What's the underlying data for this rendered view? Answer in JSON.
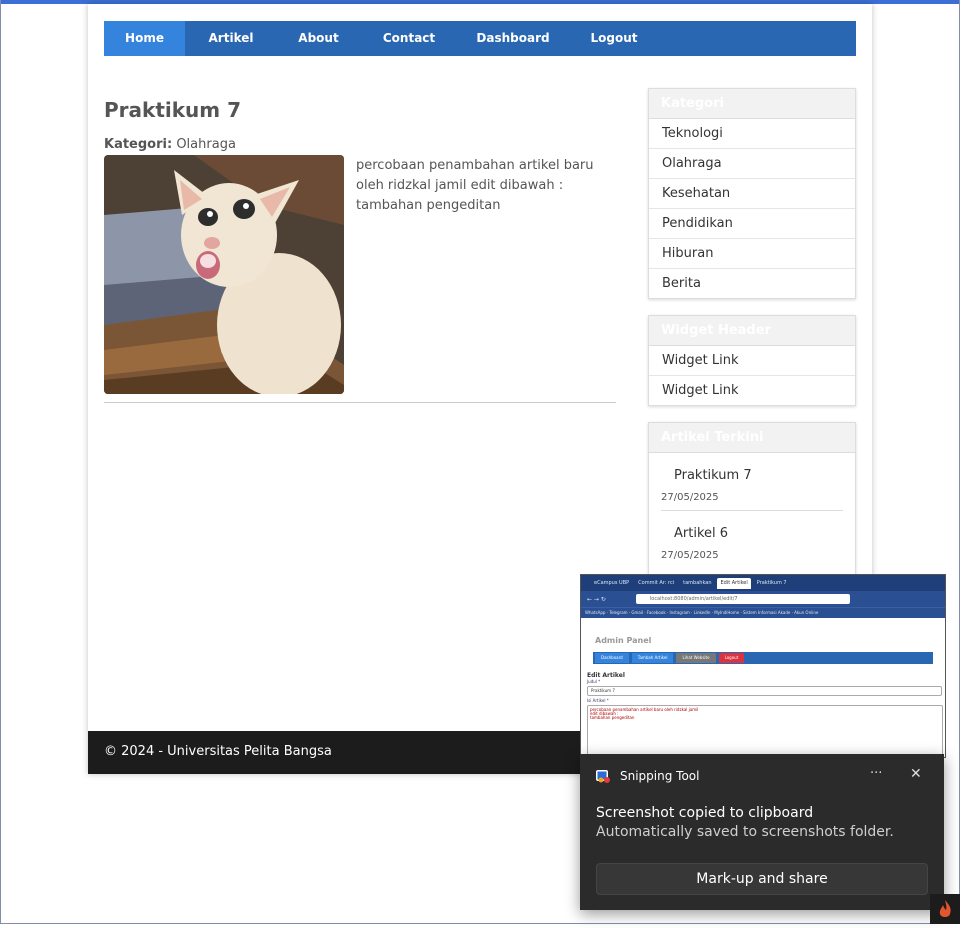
{
  "nav": {
    "items": [
      "Home",
      "Artikel",
      "About",
      "Contact",
      "Dashboard",
      "Logout"
    ],
    "active": "Home"
  },
  "article": {
    "title": "Praktikum 7",
    "category_label": "Kategori:",
    "category_value": "Olahraga",
    "body": "percobaan penambahan artikel baru oleh ridzkal jamil edit dibawah : tambahan pengeditan",
    "image_icon": "cat-photo"
  },
  "sidebar": {
    "kategori": {
      "header": "Kategori",
      "items": [
        "Teknologi",
        "Olahraga",
        "Kesehatan",
        "Pendidikan",
        "Hiburan",
        "Berita"
      ]
    },
    "widget": {
      "header": "Widget Header",
      "items": [
        "Widget Link",
        "Widget Link"
      ]
    },
    "terkini": {
      "header": "Artikel Terkini",
      "items": [
        {
          "title": "Praktikum 7",
          "date": "27/05/2025"
        },
        {
          "title": "Artikel 6",
          "date": "27/05/2025"
        }
      ]
    }
  },
  "footer": {
    "text": "© 2024 - Universitas Pelita Bangsa"
  },
  "thumbnail": {
    "tabs": [
      "eCampus UBP",
      "Commit Ar: rci",
      "tambahkan",
      "Edit Artikel",
      "Praktikum 7"
    ],
    "url": "localhost:8080/admin/artikel/edit/7",
    "bookmarks": "WhatsApp · Telegram · Gmail · Facebook · Instagram · LinkedIn · MyIndiHome · Sistem Informasi Akade · Akun Online",
    "admin_title": "Admin Panel",
    "admin_nav": [
      "Dashboard",
      "Tambah Artikel",
      "Lihat Website",
      "Logout"
    ],
    "edit_heading": "Edit Artikel",
    "label_judul": "Judul *",
    "judul_value": "Praktikum 7",
    "label_isi": "Isi Artikel *",
    "isi_lines": [
      "percobaan penambahan artikel baru oleh ridzkal jamil",
      "edit dibawah :",
      "tambahan pengeditan"
    ]
  },
  "toast": {
    "app_name": "Snipping Tool",
    "more": "···",
    "close": "✕",
    "line1": "Screenshot copied to clipboard",
    "line2": "Automatically saved to screenshots folder.",
    "button": "Mark-up and share"
  },
  "colors": {
    "nav": "#2a67b3",
    "nav_active": "#3483dd",
    "footer": "#1c1c1c",
    "toast": "#2b2b2b"
  }
}
